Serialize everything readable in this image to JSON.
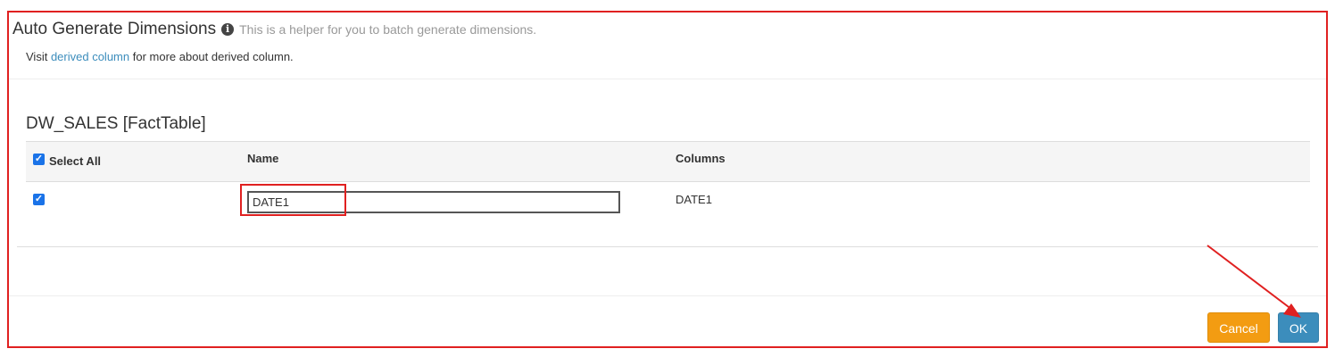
{
  "modal": {
    "title": "Auto Generate Dimensions",
    "helper": "This is a helper for you to batch generate dimensions.",
    "visit_prefix": "Visit",
    "visit_link": "derived column",
    "visit_suffix": "for more about derived column."
  },
  "table": {
    "title": "DW_SALES [FactTable]",
    "headers": {
      "select_all": "Select All",
      "name": "Name",
      "columns": "Columns"
    },
    "rows": [
      {
        "checked": true,
        "name": "DATE1",
        "column": "DATE1"
      }
    ]
  },
  "buttons": {
    "cancel": "Cancel",
    "ok": "OK"
  },
  "colors": {
    "annotation_red": "#e02020",
    "cancel": "#f39c12",
    "ok": "#3c8dbc",
    "link": "#3c8dbc"
  }
}
